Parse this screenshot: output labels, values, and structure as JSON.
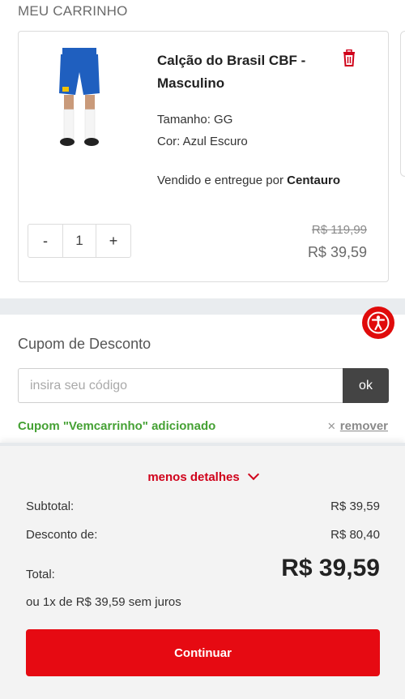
{
  "cart": {
    "title": "MEU CARRINHO",
    "item": {
      "name": "Calção do Brasil CBF - Masculino",
      "size_label": "Tamanho: GG",
      "color_label": "Cor: Azul Escuro",
      "seller_prefix": "Vendido e entregue por ",
      "seller_name": "Centauro",
      "quantity": "1",
      "decrement_label": "-",
      "increment_label": "+",
      "old_price": "R$ 119,99",
      "price": "R$ 39,59",
      "image_icon": "product-photo-shorts",
      "remove_icon": "trash-icon"
    }
  },
  "coupon": {
    "title": "Cupom de Desconto",
    "placeholder": "insira seu código",
    "value": "",
    "apply_label": "ok",
    "added_message": "Cupom \"Vemcarrinho\" adicionado",
    "remove_label": "remover",
    "remove_icon_glyph": "✕"
  },
  "summary": {
    "toggle_label": "menos detalhes",
    "subtotal_label": "Subtotal:",
    "subtotal_value": "R$ 39,59",
    "discount_label": "Desconto de:",
    "discount_value": "R$ 80,40",
    "total_label": "Total:",
    "total_value": "R$ 39,59",
    "installments": "ou 1x de R$ 39,59 sem juros",
    "continue_label": "Continuar"
  },
  "accessibility": {
    "icon": "accessibility-icon"
  },
  "colors": {
    "brand_red": "#e60a12",
    "success_green": "#45a134",
    "link_red": "#d0021b"
  }
}
